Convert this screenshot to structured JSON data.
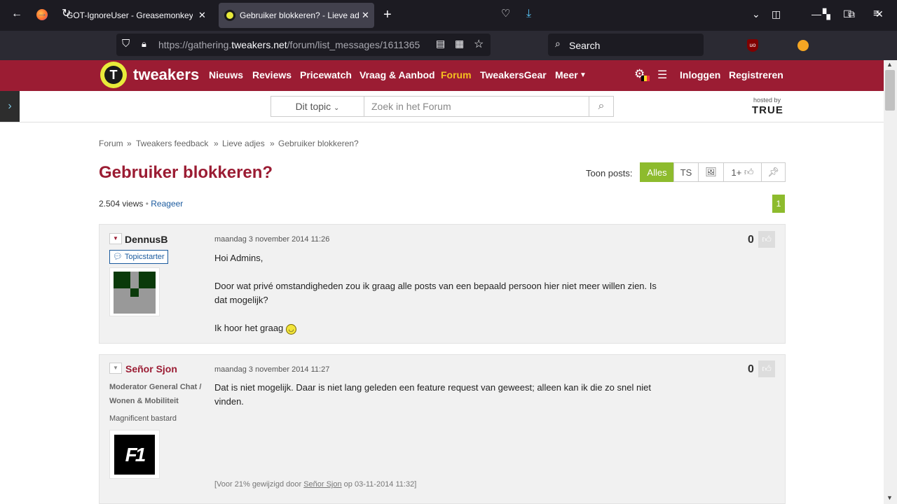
{
  "browser": {
    "tabs": [
      {
        "title": "GOT-IgnoreUser - Greasemonkey Us",
        "active": false
      },
      {
        "title": "Gebruiker blokkeren? - Lieve adjes",
        "active": true
      }
    ],
    "new_tab_icon": "plus-icon",
    "url_prefix": "https://gathering.",
    "url_domain": "tweakers.net",
    "url_path": "/forum/list_messages/1611365",
    "search_placeholder": "Search"
  },
  "site": {
    "brand": "tweakers",
    "nav": [
      "Nieuws",
      "Reviews",
      "Pricewatch",
      "Vraag & Aanbod",
      "Forum",
      "TweakersGear",
      "Meer"
    ],
    "active_nav": "Forum",
    "login": "Inloggen",
    "register": "Registreren",
    "search_scope": "Dit topic",
    "search_placeholder": "Zoek in het Forum",
    "hosted_by": "hosted by",
    "host": "TRUE"
  },
  "breadcrumb": [
    "Forum",
    "Tweakers feedback",
    "Lieve adjes",
    "Gebruiker blokkeren?"
  ],
  "topic": {
    "title": "Gebruiker blokkeren?",
    "views": "2.504 views",
    "reply": "Reageer",
    "page": "1",
    "show_posts_label": "Toon posts:",
    "filters": [
      "Alles",
      "TS",
      "",
      "1+",
      ""
    ]
  },
  "posts": [
    {
      "user": "DennusB",
      "badge": "Topicstarter",
      "time": "maandag 3 november 2014 11:26",
      "score": "0",
      "lines": [
        "Hoi Admins,",
        "Door wat privé omstandigheden zou ik graag alle posts van een bepaald persoon hier niet meer willen zien. Is dat mogelijk?",
        "Ik hoor het graag"
      ]
    },
    {
      "user": "Señor Sjon",
      "role": "Moderator General Chat / Wonen & Mobiliteit",
      "tagline": "Magnificent bastard",
      "time": "maandag 3 november 2014 11:27",
      "score": "0",
      "lines": [
        "Dat is niet mogelijk. Daar is niet lang geleden een feature request van geweest; alleen kan ik die zo snel niet vinden."
      ],
      "edit_prefix": "[Voor 21% gewijzigd door ",
      "edit_user": "Señor Sjon",
      "edit_suffix": " op 03-11-2014 11:32]"
    }
  ],
  "colors": {
    "accent": "#9b1c33",
    "green": "#8dbb2d",
    "link": "#1a5a9e"
  }
}
